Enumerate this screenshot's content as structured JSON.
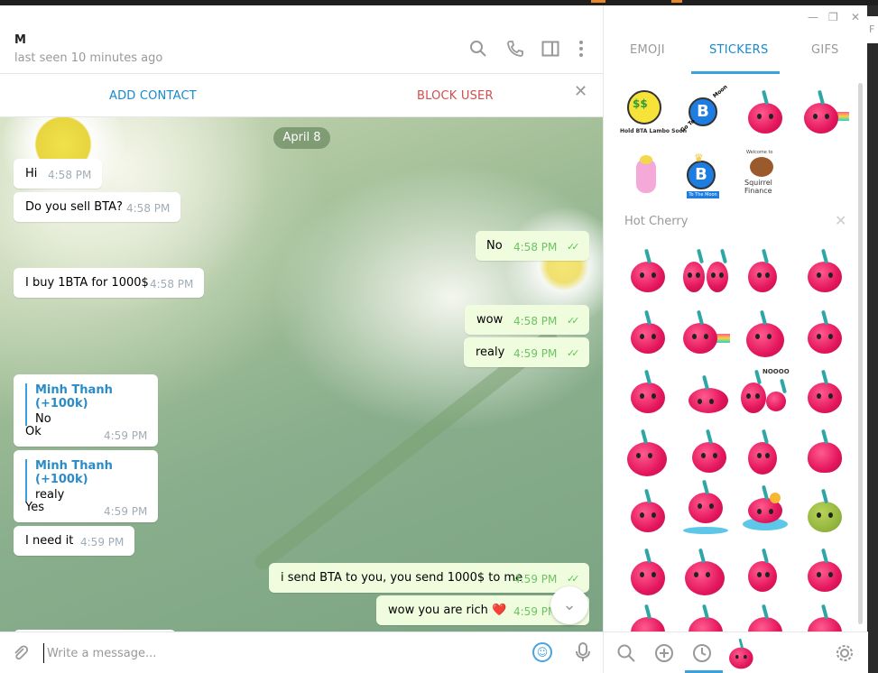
{
  "chat": {
    "peer_name": "M",
    "peer_status": "last seen 10 minutes ago",
    "add_contact": "ADD CONTACT",
    "block_user": "BLOCK USER",
    "date": "April 8",
    "messages": [
      {
        "dir": "in",
        "text": "Hi",
        "time": "4:58 PM"
      },
      {
        "dir": "in",
        "text": "Do you sell BTA?",
        "time": "4:58 PM"
      },
      {
        "dir": "out",
        "text": "No",
        "time": "4:58 PM"
      },
      {
        "dir": "in",
        "text": "I buy 1BTA for 1000$",
        "time": "4:58 PM"
      },
      {
        "dir": "out",
        "text": "wow",
        "time": "4:58 PM"
      },
      {
        "dir": "out",
        "text": "realy",
        "time": "4:59 PM"
      },
      {
        "dir": "in",
        "reply_name": "Minh Thanh (+100k)",
        "reply_text": "No",
        "text": "Ok",
        "time": "4:59 PM"
      },
      {
        "dir": "in",
        "reply_name": "Minh Thanh (+100k)",
        "reply_text": "realy",
        "text": "Yes",
        "time": "4:59 PM"
      },
      {
        "dir": "in",
        "text": "I need it",
        "time": "4:59 PM"
      },
      {
        "dir": "out",
        "text": "i send BTA to you, you send 1000$ to me",
        "time": "4:59 PM"
      },
      {
        "dir": "out",
        "text": "wow you are rich ❤️",
        "time": "4:59 PM"
      }
    ],
    "compose_placeholder": "Write a message..."
  },
  "panel": {
    "tabs": [
      "EMOJI",
      "STICKERS",
      "GIFS"
    ],
    "active_tab": "STICKERS",
    "set_title": "Hot Cherry",
    "recent_stickers": [
      "bta-money-sticker",
      "bitcoin-rocket-sticker",
      "cherry-sticker",
      "cherry-rainbow-sticker",
      "unicorn-sticker",
      "bitcoin-crown-sticker",
      "squirrel-finance-sticker"
    ],
    "sticker_texts": {
      "s1": "Hold BTA Lambo Soon",
      "s2": "Moon",
      "s2b": "Go To",
      "s6": "To The Moon",
      "s7": "Squirrel Finance",
      "s7b": "Welcome to",
      "nooo": "NOOOO"
    }
  },
  "colors": {
    "accent": "#168acd",
    "danger": "#d14e4e",
    "outgoing": "#effdde",
    "check": "#5dc452"
  }
}
